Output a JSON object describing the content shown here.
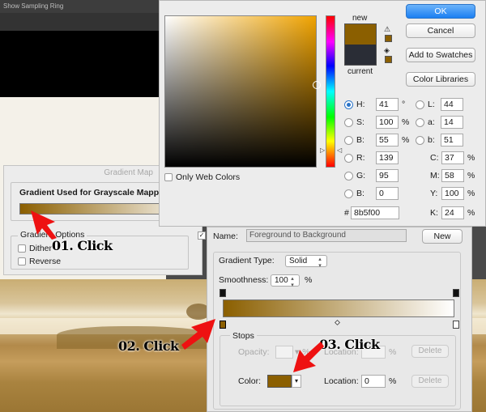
{
  "background": {
    "topbar_text": "Show Sampling Ring"
  },
  "gradient_map": {
    "title": "Gradient Map",
    "gradient_label": "Gradient Used for Grayscale Mapping",
    "options_label": "Gradient Options",
    "dither_label": "Dither",
    "reverse_label": "Reverse"
  },
  "color_picker": {
    "new_label": "new",
    "current_label": "current",
    "new_color": "#8b5f00",
    "current_color": "#2a2d36",
    "ok_label": "OK",
    "cancel_label": "Cancel",
    "add_swatches_label": "Add to Swatches",
    "color_libraries_label": "Color Libraries",
    "web_only_label": "Only Web Colors",
    "h": {
      "label": "H:",
      "value": "41",
      "unit": "°"
    },
    "s": {
      "label": "S:",
      "value": "100",
      "unit": "%"
    },
    "b": {
      "label": "B:",
      "value": "55",
      "unit": "%"
    },
    "r": {
      "label": "R:",
      "value": "139"
    },
    "g": {
      "label": "G:",
      "value": "95"
    },
    "bl": {
      "label": "B:",
      "value": "0"
    },
    "hex_label": "#",
    "hex": "8b5f00",
    "lab_l": {
      "label": "L:",
      "value": "44"
    },
    "lab_a": {
      "label": "a:",
      "value": "14"
    },
    "lab_b": {
      "label": "b:",
      "value": "51"
    },
    "c": {
      "label": "C:",
      "value": "37",
      "unit": "%"
    },
    "m": {
      "label": "M:",
      "value": "58",
      "unit": "%"
    },
    "y": {
      "label": "Y:",
      "value": "100",
      "unit": "%"
    },
    "k": {
      "label": "K:",
      "value": "24",
      "unit": "%"
    }
  },
  "gradient_editor": {
    "name_label": "Name:",
    "name_value": "Foreground to Background",
    "new_label": "New",
    "type_label": "Gradient Type:",
    "type_value": "Solid",
    "smoothness_label": "Smoothness:",
    "smoothness_value": "100",
    "smoothness_unit": "%",
    "stops_label": "Stops",
    "opacity_label": "Opacity:",
    "opacity_unit": "%",
    "location_label": "Location:",
    "location_unit": "%",
    "delete_label": "Delete",
    "color_label": "Color:",
    "color_location_value": "0",
    "stop_color": "#8b5f00"
  },
  "annotations": {
    "step1": "01. Click",
    "step2": "02. Click",
    "step3": "03. Click",
    "arrow_color": "#ee1111"
  }
}
